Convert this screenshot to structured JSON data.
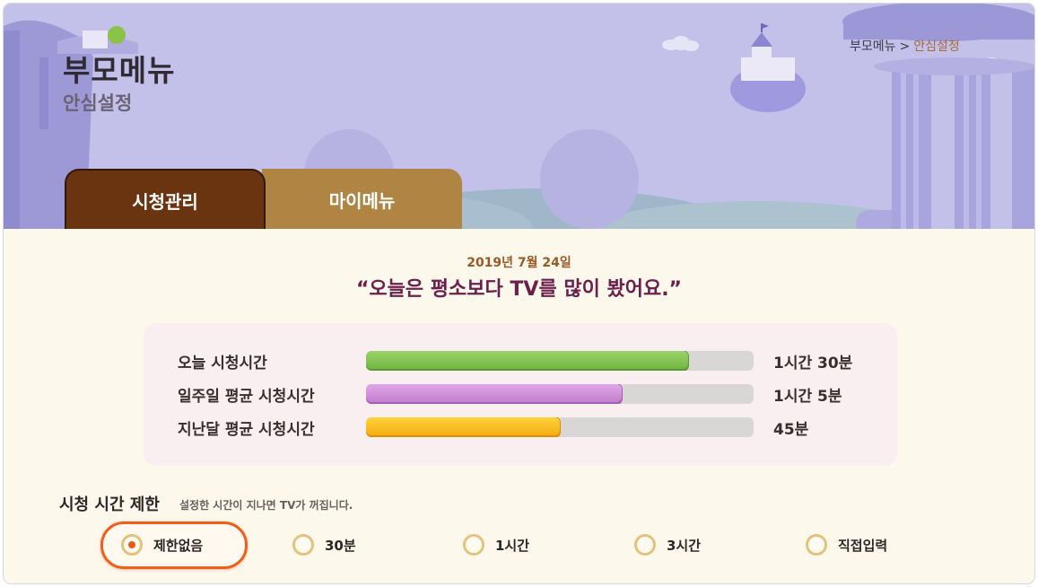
{
  "header": {
    "title": "부모메뉴",
    "subtitle": "안심설정",
    "breadcrumb": {
      "parent": "부모메뉴",
      "separator": ">",
      "current": "안심설정"
    }
  },
  "tabs": [
    {
      "label": "시청관리",
      "active": true
    },
    {
      "label": "마이메뉴",
      "active": false
    }
  ],
  "summary": {
    "date": "2019년 7월 24일",
    "headline": "“오늘은 평소보다 TV를 많이 봤어요.”"
  },
  "stats": [
    {
      "label": "오늘 시청시간",
      "value": "1시간 30분",
      "progress": 0.83,
      "color": "#7cc14b"
    },
    {
      "label": "일주일 평균 시청시간",
      "value": "1시간 5분",
      "progress": 0.66,
      "color": "#cf8bd6"
    },
    {
      "label": "지난달 평균 시청시간",
      "value": "45분",
      "progress": 0.5,
      "color": "#fbbd20"
    }
  ],
  "limit": {
    "title": "시청 시간 제한",
    "description": "설정한 시간이 지나면 TV가 꺼집니다.",
    "options": [
      {
        "label": "제한없음",
        "selected": true
      },
      {
        "label": "30분",
        "selected": false
      },
      {
        "label": "1시간",
        "selected": false
      },
      {
        "label": "3시간",
        "selected": false
      },
      {
        "label": "직접입력",
        "selected": false
      }
    ]
  },
  "colors": {
    "header_bg": "#c3c1ea",
    "content_bg": "#fdf8ec",
    "tab_active": "#6b3410",
    "tab_inactive": "#b08544",
    "headline": "#6b1f4a",
    "date": "#9a5a28",
    "breadcrumb_current": "#a86b38",
    "selection_accent": "#f15e1c"
  }
}
